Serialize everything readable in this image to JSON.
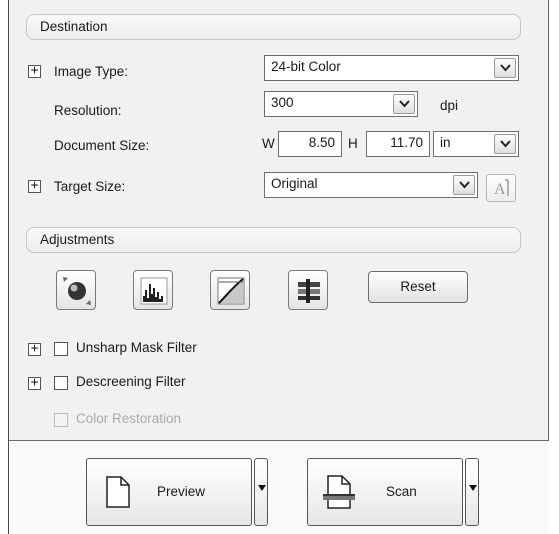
{
  "destination": {
    "section_title": "Destination",
    "image_type": {
      "label": "Image Type:",
      "value": "24-bit Color"
    },
    "resolution": {
      "label": "Resolution:",
      "value": "300",
      "unit": "dpi"
    },
    "document_size": {
      "label": "Document Size:",
      "w_label": "W",
      "w_value": "8.50",
      "h_label": "H",
      "h_value": "11.70",
      "unit": "in"
    },
    "target_size": {
      "label": "Target Size:",
      "value": "Original"
    }
  },
  "adjustments": {
    "section_title": "Adjustments",
    "tools": [
      {
        "name": "auto-exposure-icon"
      },
      {
        "name": "histogram-icon"
      },
      {
        "name": "tone-curve-icon"
      },
      {
        "name": "color-palette-icon"
      }
    ],
    "reset_label": "Reset",
    "filters": [
      {
        "label": "Unsharp Mask Filter",
        "checked": false,
        "enabled": true
      },
      {
        "label": "Descreening Filter",
        "checked": false,
        "enabled": true
      },
      {
        "label": "Color Restoration",
        "checked": false,
        "enabled": false
      }
    ]
  },
  "actions": {
    "preview_label": "Preview",
    "scan_label": "Scan"
  },
  "colors": {
    "panel_bg": "#f1f1f1",
    "border": "#6e6e6e",
    "disabled_text": "#aaaaaa"
  }
}
